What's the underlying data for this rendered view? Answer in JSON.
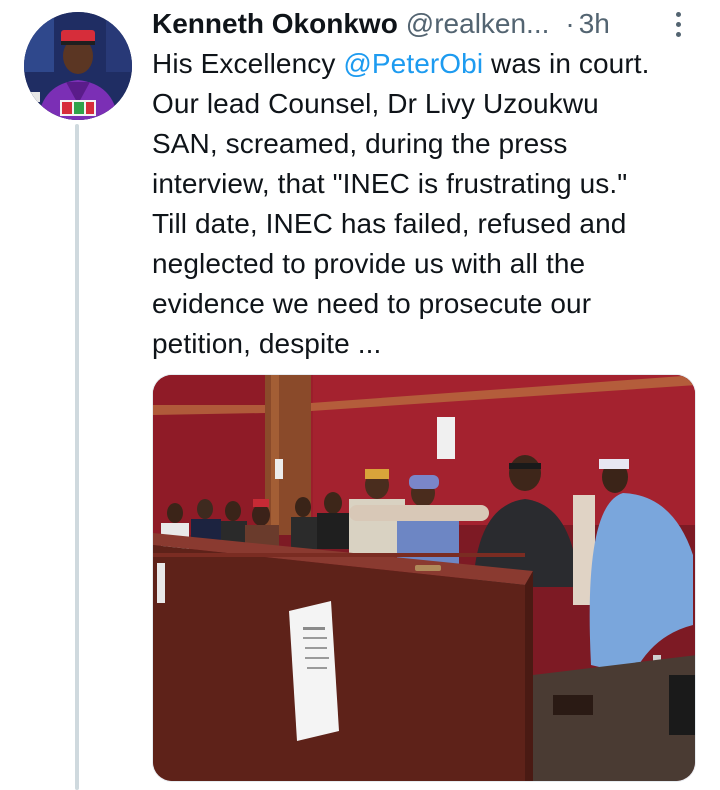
{
  "tweet": {
    "author_name": "Kenneth Okonkwo",
    "author_handle": "@realken...",
    "separator": "·",
    "timestamp": "3h",
    "text_lines": [
      {
        "parts": [
          {
            "text": "His Excellency ",
            "type": "text"
          },
          {
            "text": "@PeterObi",
            "type": "mention"
          },
          {
            "text": " was in court.",
            "type": "text"
          }
        ]
      },
      {
        "parts": [
          {
            "text": "Our lead Counsel, Dr Livy Uzoukwu",
            "type": "text"
          }
        ]
      },
      {
        "parts": [
          {
            "text": "SAN, screamed, during the press",
            "type": "text"
          }
        ]
      },
      {
        "parts": [
          {
            "text": "interview, that \"INEC is frustrating us.\"",
            "type": "text"
          }
        ]
      },
      {
        "parts": [
          {
            "text": "Till date, INEC has failed, refused and",
            "type": "text"
          }
        ]
      },
      {
        "parts": [
          {
            "text": "neglected to provide us with all the",
            "type": "text"
          }
        ]
      },
      {
        "parts": [
          {
            "text": "evidence we need to prosecute our",
            "type": "text"
          }
        ]
      },
      {
        "parts": [
          {
            "text": "petition, despite ...",
            "type": "text"
          }
        ]
      }
    ]
  },
  "colors": {
    "text": "#0f1419",
    "secondary": "#536471",
    "link": "#1d9bf0",
    "thread_line": "#cfd9de",
    "court_wall": "#9b1e2c",
    "court_wood": "#6b2a1f"
  },
  "icons": {
    "more": "more-dots-icon"
  }
}
